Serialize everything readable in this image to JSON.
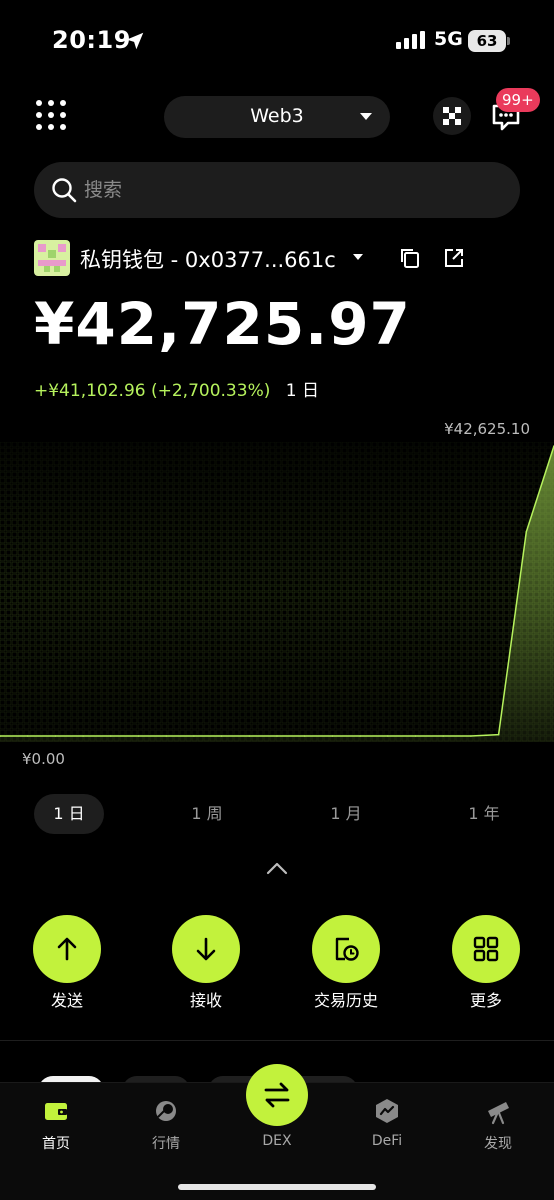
{
  "status_bar": {
    "time": "20:19",
    "network": "5G",
    "battery": "63"
  },
  "header": {
    "network_selector": "Web3",
    "notification_badge": "99+"
  },
  "search": {
    "placeholder": "搜索"
  },
  "wallet": {
    "name": "私钥钱包 - 0x0377...661c",
    "balance": "¥42,725.97",
    "pnl_change": "+¥41,102.96 (+2,700.33%)",
    "pnl_period": "1 日"
  },
  "chart": {
    "max_label": "¥42,625.10",
    "min_label": "¥0.00",
    "accent_color": "#b6f25d"
  },
  "chart_data": {
    "type": "area",
    "x": [
      0,
      1,
      2,
      3,
      4,
      5,
      6,
      7,
      8,
      9,
      10,
      11,
      12,
      13,
      14,
      15,
      16,
      17,
      18,
      19,
      20
    ],
    "values": [
      0,
      0,
      0,
      0,
      0,
      0,
      0,
      0,
      0,
      0,
      0,
      0,
      0,
      0,
      0,
      0,
      0,
      0,
      200,
      30000,
      42625.1
    ],
    "ylim": [
      0,
      42625.1
    ]
  },
  "range_tabs": [
    {
      "label": "1 日",
      "active": true
    },
    {
      "label": "1 周",
      "active": false
    },
    {
      "label": "1 月",
      "active": false
    },
    {
      "label": "1 年",
      "active": false
    }
  ],
  "actions": [
    {
      "label": "发送",
      "icon": "arrow-up-icon"
    },
    {
      "label": "接收",
      "icon": "arrow-down-icon"
    },
    {
      "label": "交易历史",
      "icon": "history-icon"
    },
    {
      "label": "更多",
      "icon": "grid-icon"
    }
  ],
  "bottom_nav": [
    {
      "label": "首页",
      "icon": "wallet-icon",
      "active": true
    },
    {
      "label": "行情",
      "icon": "market-icon",
      "active": false
    },
    {
      "label": "DEX",
      "icon": "swap-icon",
      "active": false
    },
    {
      "label": "DeFi",
      "icon": "defi-icon",
      "active": false
    },
    {
      "label": "发现",
      "icon": "telescope-icon",
      "active": false
    }
  ],
  "colors": {
    "accent": "#c2f23c",
    "positive": "#b6f25d",
    "badge": "#ea3a5b"
  }
}
